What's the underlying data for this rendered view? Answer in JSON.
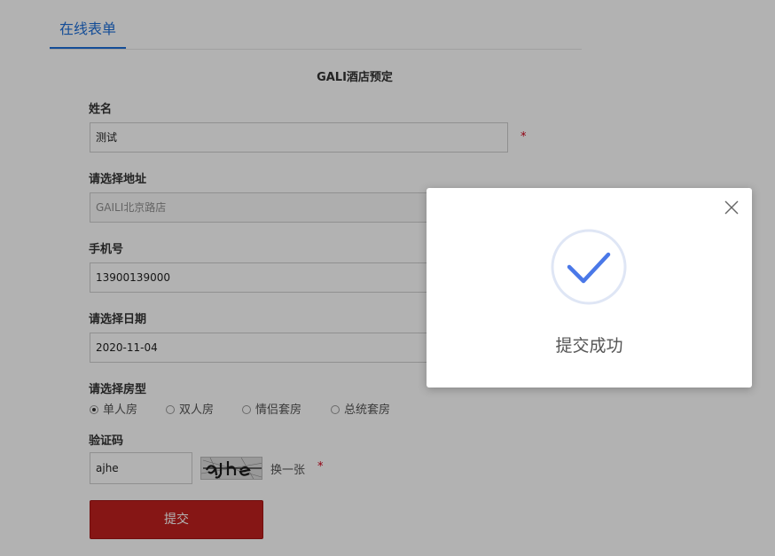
{
  "tab": {
    "label": "在线表单"
  },
  "form": {
    "title": "GALI酒店预定",
    "name_label": "姓名",
    "name_value": "测试",
    "address_label": "请选择地址",
    "address_value": "GAILI北京路店",
    "phone_label": "手机号",
    "phone_value": "13900139000",
    "date_label": "请选择日期",
    "date_value": "2020-11-04",
    "room_label": "请选择房型",
    "room_options": [
      "单人房",
      "双人房",
      "情侣套房",
      "总统套房"
    ],
    "room_selected": "单人房",
    "captcha_label": "验证码",
    "captcha_value": "ajhe",
    "captcha_image_text": "ajhe",
    "refresh_label": "换一张",
    "required_mark": "*",
    "submit_label": "提交"
  },
  "modal": {
    "message": "提交成功",
    "icon": "check-circle-icon",
    "close_icon": "close-icon"
  },
  "colors": {
    "accent": "#1e6fd9",
    "submit": "#c0201f",
    "required": "#d0021b",
    "check": "#4a78e8",
    "overlay": "rgba(0,0,0,0.30)"
  }
}
